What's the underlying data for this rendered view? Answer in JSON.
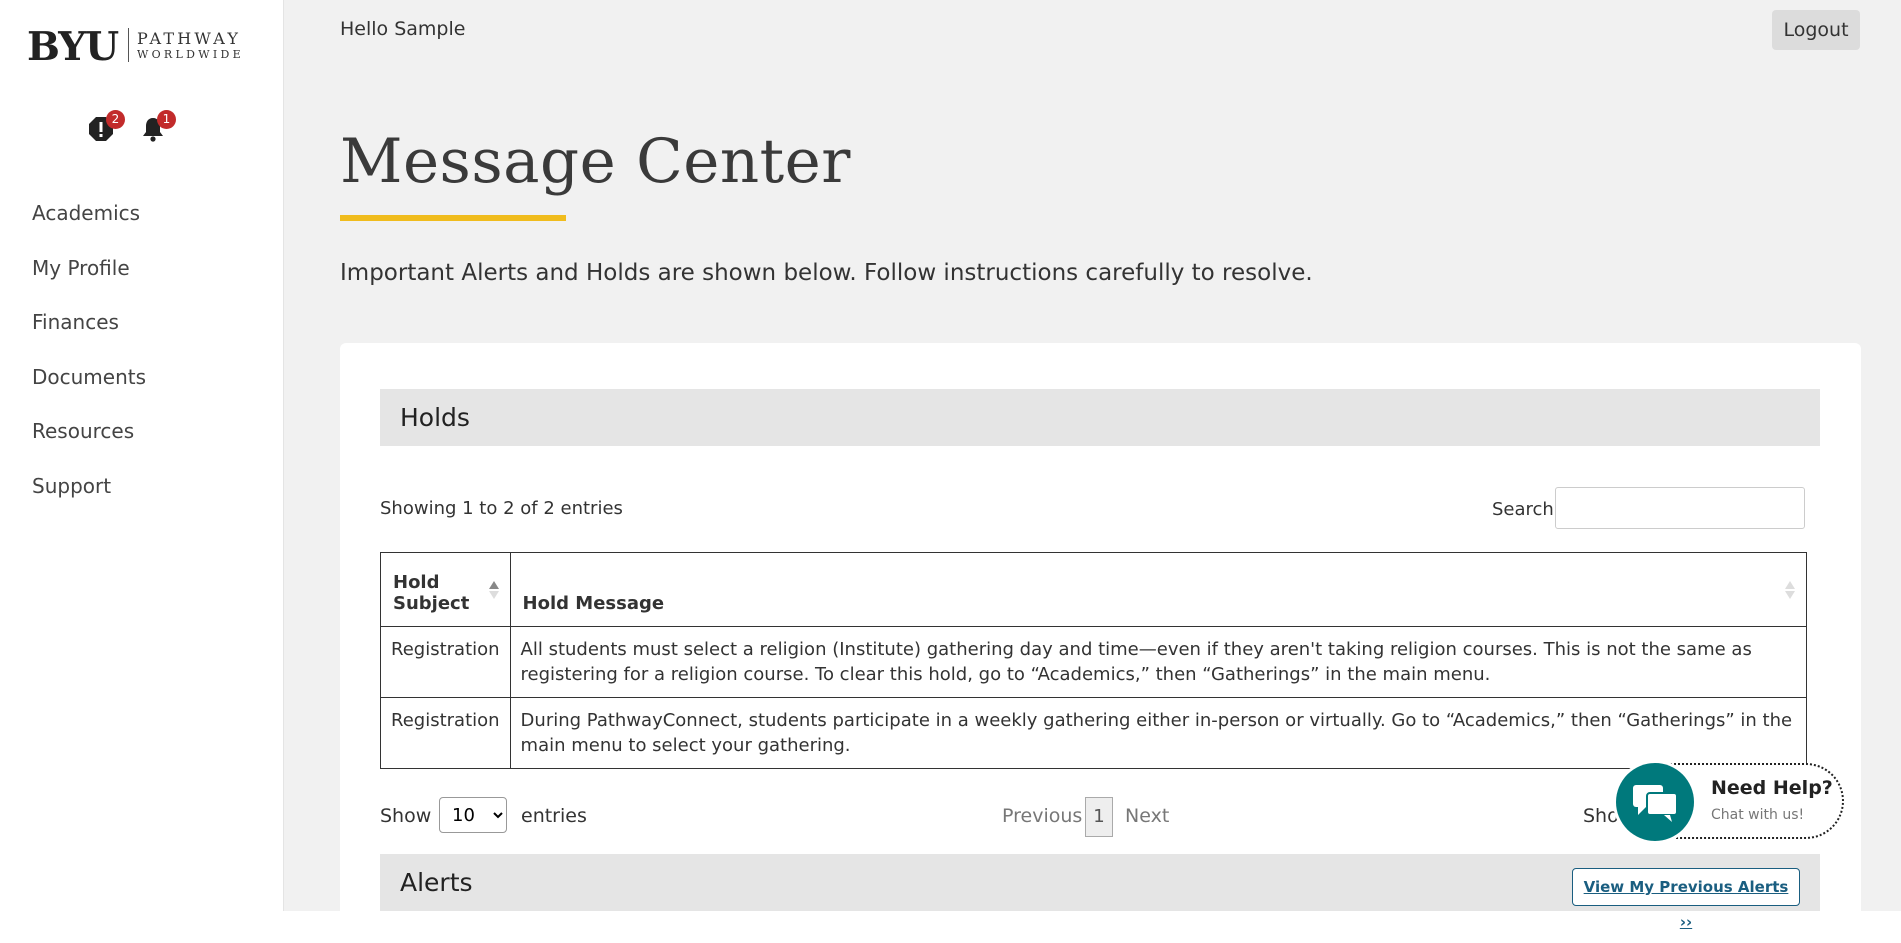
{
  "brand": {
    "name": "BYU",
    "line1": "PATHWAY",
    "line2": "WORLDWIDE"
  },
  "sidebar": {
    "holds_badge": "2",
    "notifications_badge": "1",
    "items": [
      {
        "label": "Academics"
      },
      {
        "label": "My Profile"
      },
      {
        "label": "Finances"
      },
      {
        "label": "Documents"
      },
      {
        "label": "Resources"
      },
      {
        "label": "Support"
      }
    ]
  },
  "header": {
    "greeting": "Hello Sample",
    "logout_label": "Logout"
  },
  "page": {
    "title": "Message Center",
    "intro": "Important Alerts and Holds are shown below. Follow instructions carefully to resolve."
  },
  "holds": {
    "title": "Holds",
    "showing": "Showing 1 to 2 of 2 entries",
    "search_label": "Search",
    "search_value": "",
    "columns": [
      "Hold\nSubject",
      "Hold Message"
    ],
    "rows": [
      {
        "subject": "Registration",
        "message": "All students must select a religion (Institute) gathering day and time—even if they aren't taking religion courses. This is not the same as registering for a religion course. To clear this hold, go to “Academics,” then “Gatherings” in the main menu."
      },
      {
        "subject": "Registration",
        "message": "During PathwayConnect, students participate in a weekly gathering either in-person or virtually. Go to “Academics,” then “Gatherings” in the main menu to select your gathering."
      }
    ],
    "show_label": "Show",
    "page_length": "10",
    "entries_label": "entries",
    "previous_label": "Previous",
    "current_page": "1",
    "next_label": "Next",
    "show_truncated": "Show"
  },
  "alerts": {
    "title": "Alerts",
    "previous_button": "View My Previous Alerts ››"
  },
  "chat": {
    "title": "Need Help?",
    "subtitle": "Chat with us!"
  },
  "colors": {
    "accent_underline": "#f0bc1d",
    "badge": "#c22b2b",
    "chat_teal": "#00797c",
    "link_blue": "#1a5e80"
  }
}
